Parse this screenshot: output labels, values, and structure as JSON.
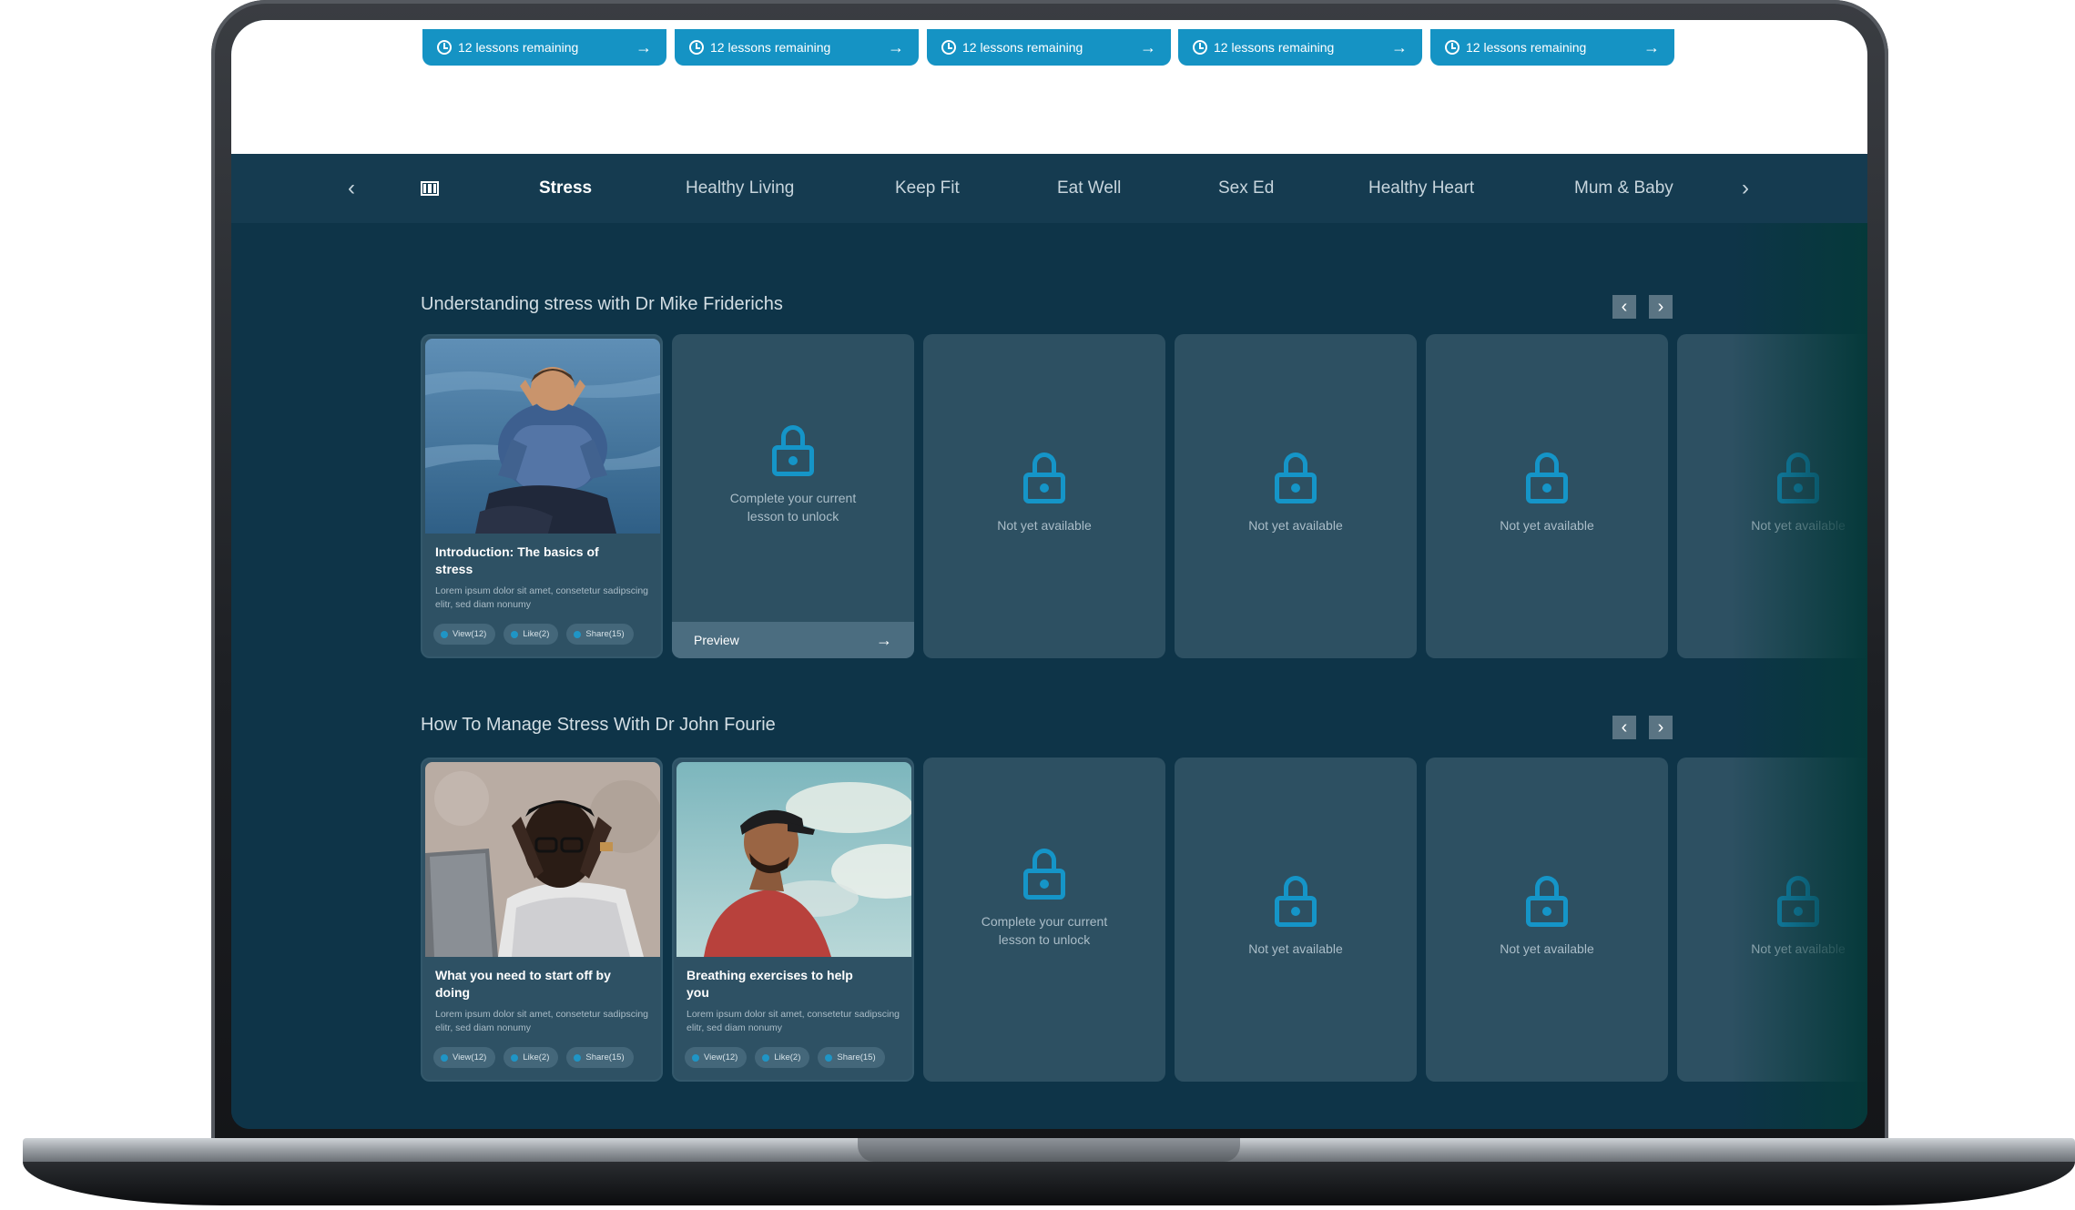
{
  "progress_pills": [
    {
      "label": "12 lessons remaining"
    },
    {
      "label": "12 lessons remaining"
    },
    {
      "label": "12 lessons remaining"
    },
    {
      "label": "12 lessons remaining"
    },
    {
      "label": "12 lessons remaining"
    }
  ],
  "nav": {
    "prev": "‹",
    "next": "›",
    "tabs": [
      {
        "label": "Stress",
        "active": true
      },
      {
        "label": "Healthy Living"
      },
      {
        "label": "Keep Fit"
      },
      {
        "label": "Eat Well"
      },
      {
        "label": "Sex Ed"
      },
      {
        "label": "Healthy Heart"
      },
      {
        "label": "Mum & Baby"
      }
    ]
  },
  "sections": [
    {
      "title": "Understanding stress with Dr Mike Friderichs",
      "prev": "‹",
      "next": "›",
      "lesson": {
        "title": "Introduction: The basics of stress",
        "desc": "Lorem ipsum dolor sit amet, consetetur sadipscing elitr, sed diam nonumy",
        "chips": [
          "View(12)",
          "Like(2)",
          "Share(15)"
        ]
      },
      "unlock_card": {
        "text": "Complete your current lesson to unlock",
        "preview": "Preview",
        "arrow": "→"
      },
      "locked": [
        "Not yet available",
        "Not yet available",
        "Not yet available",
        "Not yet available"
      ]
    },
    {
      "title": "How To Manage Stress With Dr John Fourie",
      "prev": "‹",
      "next": "›",
      "lessons": [
        {
          "title": "What you need to start off by doing",
          "desc": "Lorem ipsum dolor sit amet, consetetur sadipscing elitr, sed diam nonumy",
          "chips": [
            "View(12)",
            "Like(2)",
            "Share(15)"
          ]
        },
        {
          "title": "Breathing exercises to help you",
          "desc": "Lorem ipsum dolor sit amet, consetetur sadipscing elitr, sed diam nonumy",
          "chips": [
            "View(12)",
            "Like(2)",
            "Share(15)"
          ]
        }
      ],
      "unlock_card": {
        "text": "Complete your current lesson to unlock"
      },
      "locked": [
        "Not yet available",
        "Not yet available",
        "Not yet available"
      ]
    }
  ],
  "colors": {
    "accent": "#1593c4",
    "nav_bg": "#153b50",
    "content_bg": "#0e3448",
    "card_bg": "#2d5062"
  }
}
